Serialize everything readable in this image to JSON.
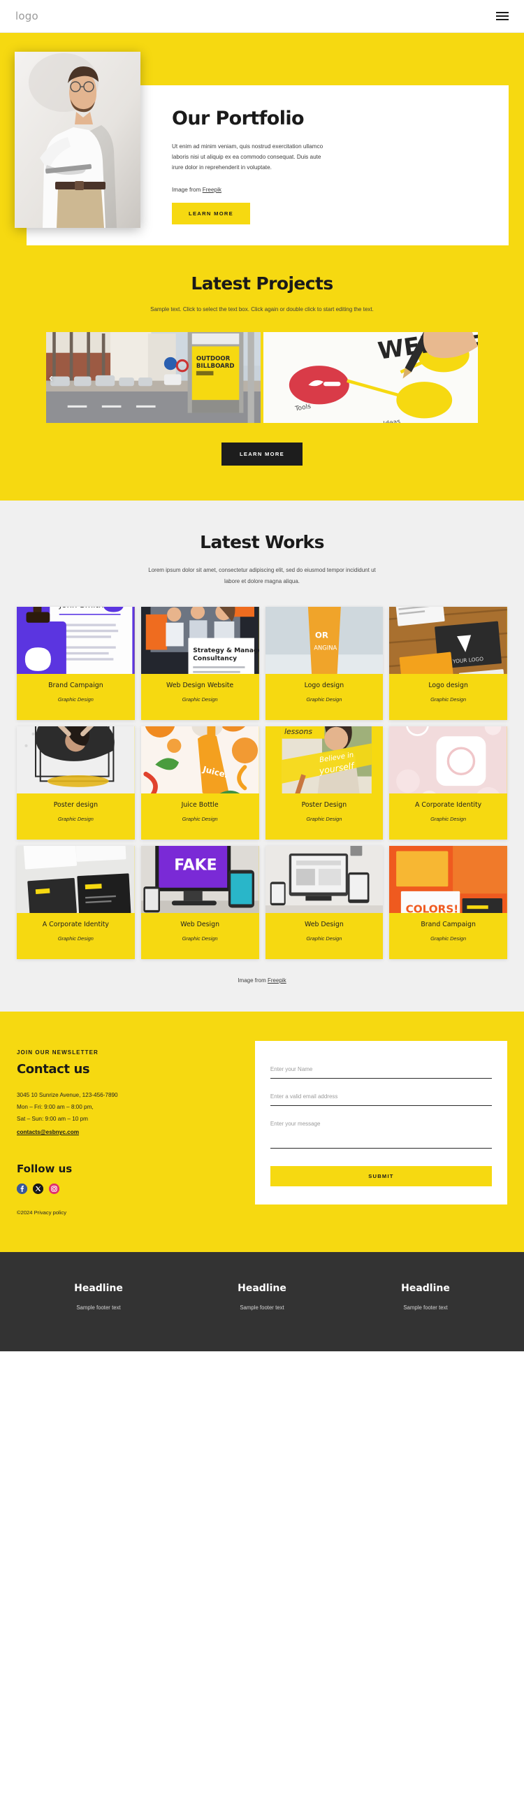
{
  "header": {
    "logo": "logo",
    "menu_icon": "hamburger-menu-icon"
  },
  "hero": {
    "title": "Our Portfolio",
    "paragraph": "Ut enim ad minim veniam, quis nostrud exercitation ullamco laboris nisi ut aliquip ex ea commodo consequat. Duis aute irure dolor in reprehenderit in voluptate.",
    "credit_prefix": "Image from ",
    "credit_link": "Freepik",
    "button": "LEARN MORE"
  },
  "projects": {
    "title": "Latest Projects",
    "subtitle": "Sample text. Click to select the text box. Click again or double click to start editing the text.",
    "prev_arrow": "‹",
    "button": "LEARN MORE",
    "slides": [
      {
        "alt": "outdoor-billboard-street-mockup",
        "caption": "OUTDOOR BILLBOARD"
      },
      {
        "alt": "hand-drawing-web-design-mindmap",
        "caption": "WEB DES"
      }
    ]
  },
  "works": {
    "title": "Latest Works",
    "subtitle": "Lorem ipsum dolor sit amet, consectetur adipiscing elit, sed do eiusmod tempor incididunt ut labore et dolore magna aliqua.",
    "credit_prefix": "Image from ",
    "credit_link": "Freepik",
    "cards": [
      {
        "title": "Brand Campaign",
        "meta": "Graphic Design",
        "thumb": "book-cover-purple-branding"
      },
      {
        "title": "Web Design Website",
        "meta": "Graphic Design",
        "thumb": "strategy-consultancy-website"
      },
      {
        "title": "Logo design",
        "meta": "Graphic Design",
        "thumb": "orangina-drink-cup"
      },
      {
        "title": "Logo design",
        "meta": "Graphic Design",
        "thumb": "business-cards-on-wood"
      },
      {
        "title": "Poster design",
        "meta": "Graphic Design",
        "thumb": "music-poster-black-brush"
      },
      {
        "title": "Juice Bottle",
        "meta": "Graphic Design",
        "thumb": "orange-juice-bottle"
      },
      {
        "title": "Poster Design",
        "meta": "Graphic Design",
        "thumb": "free-painting-lessons-poster"
      },
      {
        "title": "A Corporate Identity",
        "meta": "Graphic Design",
        "thumb": "pink-corporate-identity"
      },
      {
        "title": "A Corporate Identity",
        "meta": "Graphic Design",
        "thumb": "black-business-cards"
      },
      {
        "title": "Web Design",
        "meta": "Graphic Design",
        "thumb": "fake-purple-imac-screen"
      },
      {
        "title": "Web Design",
        "meta": "Graphic Design",
        "thumb": "devices-responsive-mockup"
      },
      {
        "title": "Brand Campaign",
        "meta": "Graphic Design",
        "thumb": "colorful-orange-branding"
      }
    ]
  },
  "contact": {
    "eyebrow": "JOIN OUR NEWSLETTER",
    "title": "Contact us",
    "address": "3045 10 Sunrize Avenue, 123-456-7890",
    "hours_weekday": "Mon – Fri: 9:00 am – 8:00 pm,",
    "hours_weekend": "Sat – Sun: 9:00 am – 10 pm",
    "email": "contacts@esbnyc.com",
    "follow_title": "Follow us",
    "socials": [
      {
        "name": "facebook-icon",
        "color": "#3b5998",
        "glyph": "f"
      },
      {
        "name": "x-twitter-icon",
        "color": "#1a1a1a",
        "glyph": "𝕩"
      },
      {
        "name": "instagram-icon",
        "color": "#e1306c",
        "glyph": "▢"
      }
    ],
    "copyright": "©2024 Privacy policy",
    "form": {
      "name_placeholder": "Enter your Name",
      "email_placeholder": "Enter a valid email address",
      "message_placeholder": "Enter your message",
      "submit": "SUBMIT"
    }
  },
  "footer": {
    "columns": [
      {
        "headline": "Headline",
        "text": "Sample footer text"
      },
      {
        "headline": "Headline",
        "text": "Sample footer text"
      },
      {
        "headline": "Headline",
        "text": "Sample footer text"
      }
    ]
  },
  "colors": {
    "brand_yellow": "#f6d911",
    "dark": "#1d1d1d",
    "footer_bg": "#333333",
    "works_bg": "#f0f0f0"
  }
}
